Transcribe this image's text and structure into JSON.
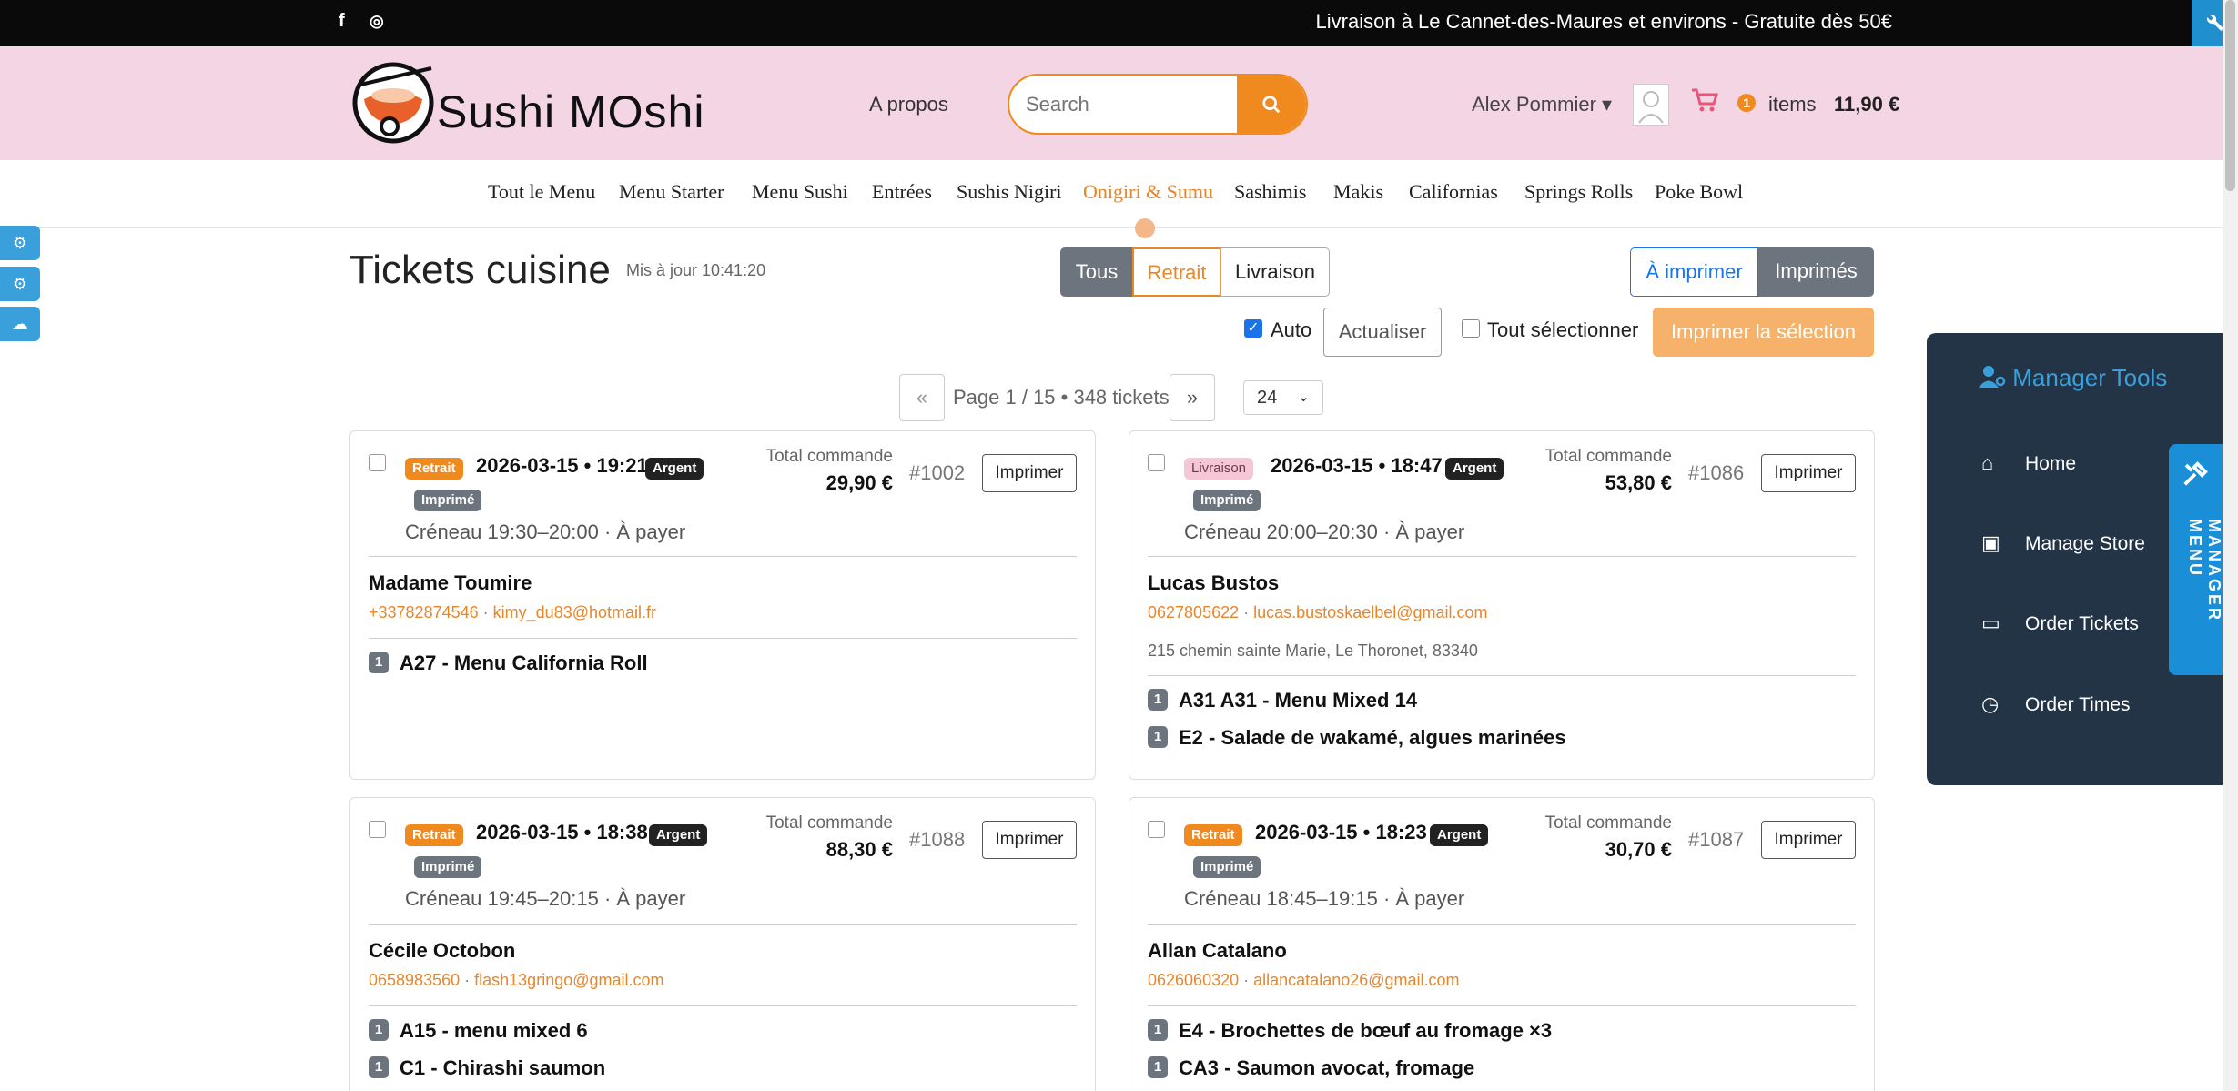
{
  "topbar": {
    "facebook_icon": "f",
    "instagram_icon": "◎",
    "promo": "Livraison à Le Cannet-des-Maures et environs - Gratuite dès 50€",
    "corner_icon": "wrench-icon"
  },
  "header": {
    "brand": "Sushi MOshi",
    "about": "A propos",
    "search_placeholder": "Search",
    "user_name": "Alex Pommier ▾",
    "cart_count": "1",
    "items_label": "items",
    "cart_total": "11,90 €"
  },
  "nav": {
    "items": [
      "Tout le Menu",
      "Menu Starter",
      "Menu Sushi",
      "Entrées",
      "Sushis Nigiri",
      "Onigiri & Sumu",
      "Sashimis",
      "Makis",
      "Californias",
      "Springs Rolls",
      "Poke Bowl"
    ],
    "active": "Onigiri & Sumu"
  },
  "page": {
    "title": "Tickets cuisine",
    "updated": "Mis à jour 10:41:20",
    "filters": [
      "Tous",
      "Retrait",
      "Livraison"
    ],
    "print_toggle": [
      "À imprimer",
      "Imprimés"
    ],
    "auto_label": "Auto",
    "refresh_label": "Actualiser",
    "select_all_label": "Tout sélectionner",
    "print_selection_label": "Imprimer la sélection",
    "pager_prev": "«",
    "pager_next": "»",
    "pager_text": "Page 1 / 15 • 348 tickets",
    "per_page": "24"
  },
  "tickets": [
    {
      "type": "Retrait",
      "datetime": "2026-03-15 • 19:21",
      "payment": "Argent",
      "status": "Imprimé",
      "total_label": "Total commande",
      "total": "29,90 €",
      "number": "#1002",
      "print_label": "Imprimer",
      "slot": "Créneau 19:30–20:00 · À payer",
      "name": "Madame Toumire",
      "phone": "+33782874546",
      "sep": "·",
      "email": "kimy_du83@hotmail.fr",
      "address": "",
      "lines": [
        {
          "qty": "1",
          "label": "A27 - Menu California Roll"
        }
      ]
    },
    {
      "type": "Livraison",
      "datetime": "2026-03-15 • 18:47",
      "payment": "Argent",
      "status": "Imprimé",
      "total_label": "Total commande",
      "total": "53,80 €",
      "number": "#1086",
      "print_label": "Imprimer",
      "slot": "Créneau 20:00–20:30 · À payer",
      "name": "Lucas Bustos",
      "phone": "0627805622",
      "sep": "·",
      "email": "lucas.bustoskaelbel@gmail.com",
      "address": "215 chemin sainte Marie, Le Thoronet, 83340",
      "lines": [
        {
          "qty": "1",
          "label": "A31 A31 - Menu Mixed 14"
        },
        {
          "qty": "1",
          "label": "E2 - Salade de wakamé, algues marinées"
        }
      ]
    },
    {
      "type": "Retrait",
      "datetime": "2026-03-15 • 18:38",
      "payment": "Argent",
      "status": "Imprimé",
      "total_label": "Total commande",
      "total": "88,30 €",
      "number": "#1088",
      "print_label": "Imprimer",
      "slot": "Créneau 19:45–20:15 · À payer",
      "name": "Cécile Octobon",
      "phone": "0658983560",
      "sep": "·",
      "email": "flash13gringo@gmail.com",
      "address": "",
      "lines": [
        {
          "qty": "1",
          "label": "A15 - menu mixed 6"
        },
        {
          "qty": "1",
          "label": "C1 - Chirashi saumon"
        }
      ]
    },
    {
      "type": "Retrait",
      "datetime": "2026-03-15 • 18:23",
      "payment": "Argent",
      "status": "Imprimé",
      "total_label": "Total commande",
      "total": "30,70 €",
      "number": "#1087",
      "print_label": "Imprimer",
      "slot": "Créneau 18:45–19:15 · À payer",
      "name": "Allan Catalano",
      "phone": "0626060320",
      "sep": "·",
      "email": "allancatalano26@gmail.com",
      "address": "",
      "lines": [
        {
          "qty": "1",
          "label": "E4 - Brochettes de bœuf au fromage ×3"
        },
        {
          "qty": "1",
          "label": "CA3 - Saumon avocat, fromage"
        }
      ]
    }
  ],
  "manager": {
    "title": "Manager Tools",
    "items": [
      "Home",
      "Manage Store",
      "Order Tickets",
      "Order Times"
    ],
    "tab_label": "MANAGER MENU"
  },
  "colors": {
    "accent": "#f08a1e",
    "header_bg": "#f4d5e3",
    "panel_bg": "#243447",
    "blue": "#1a8fd7"
  }
}
